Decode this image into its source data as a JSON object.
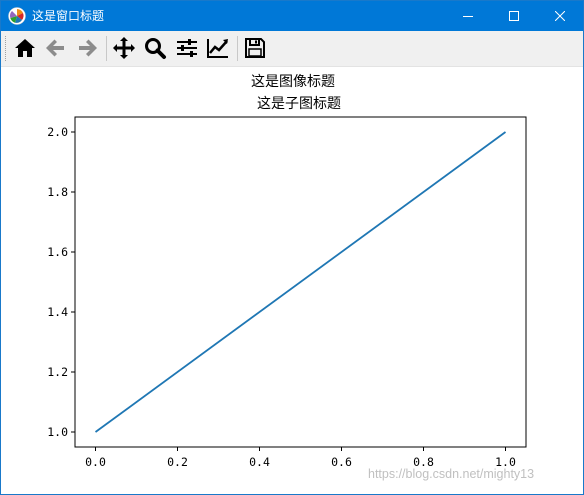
{
  "window": {
    "title": "这是窗口标题"
  },
  "toolbar": {
    "buttons": [
      {
        "name": "home-icon",
        "label": "Home"
      },
      {
        "name": "back-icon",
        "label": "Back"
      },
      {
        "name": "forward-icon",
        "label": "Forward"
      },
      {
        "name": "pan-icon",
        "label": "Pan"
      },
      {
        "name": "zoom-icon",
        "label": "Zoom"
      },
      {
        "name": "subplots-icon",
        "label": "Subplots"
      },
      {
        "name": "customize-icon",
        "label": "Customize"
      },
      {
        "name": "save-icon",
        "label": "Save"
      }
    ]
  },
  "figure": {
    "suptitle": "这是图像标题"
  },
  "chart_data": {
    "type": "line",
    "title": "这是子图标题",
    "xlabel": "",
    "ylabel": "",
    "xlim": [
      -0.05,
      1.05
    ],
    "ylim": [
      0.95,
      2.05
    ],
    "xticks": [
      "0.0",
      "0.2",
      "0.4",
      "0.6",
      "0.8",
      "1.0"
    ],
    "yticks": [
      "1.0",
      "1.2",
      "1.4",
      "1.6",
      "1.8",
      "2.0"
    ],
    "grid": false,
    "series": [
      {
        "x": [
          0.0,
          1.0
        ],
        "y": [
          1.0,
          2.0
        ],
        "color": "#1f77b4"
      }
    ]
  },
  "watermark": "https://blog.csdn.net/mighty13"
}
